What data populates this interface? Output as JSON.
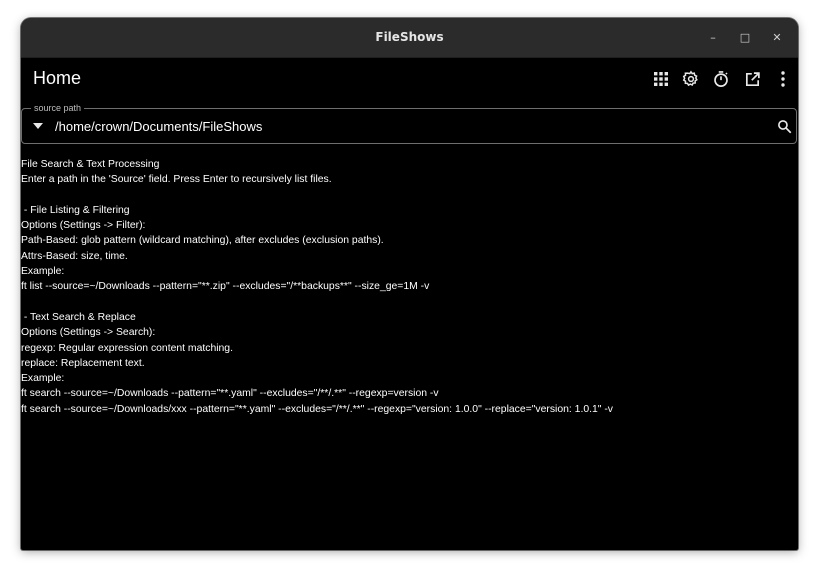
{
  "window": {
    "title": "FileShows",
    "controls": {
      "minimize": "–",
      "maximize": "□",
      "close": "✕"
    }
  },
  "appbar": {
    "title": "Home",
    "icons": [
      "grid-icon",
      "gear-icon",
      "timer-icon",
      "open-in-new-icon",
      "more-vert-icon"
    ]
  },
  "source": {
    "label": "source path",
    "value": "/home/crown/Documents/FileShows"
  },
  "help": {
    "lines": [
      "File Search & Text Processing",
      "Enter a path in the 'Source' field. Press Enter to recursively list files.",
      "",
      " - File Listing & Filtering",
      "Options (Settings -> Filter):",
      "Path-Based: glob pattern (wildcard matching), after excludes (exclusion paths).",
      "Attrs-Based: size, time.",
      "Example:",
      "ft list --source=~/Downloads --pattern=\"**.zip\" --excludes=\"/**backups**\" --size_ge=1M -v",
      "",
      " - Text Search & Replace",
      "Options (Settings -> Search):",
      "regexp: Regular expression content matching.",
      "replace: Replacement text.",
      "Example:",
      "ft search --source=~/Downloads --pattern=\"**.yaml\" --excludes=\"/**/.**\" --regexp=version -v",
      "ft search --source=~/Downloads/xxx --pattern=\"**.yaml\" --excludes=\"/**/.**\" --regexp=\"version: 1.0.0\" --replace=\"version: 1.0.1\" -v"
    ]
  },
  "colors": {
    "titlebar": "#2b2b2b",
    "background": "#000000",
    "text": "#ffffff",
    "border": "#6e6e6e"
  }
}
